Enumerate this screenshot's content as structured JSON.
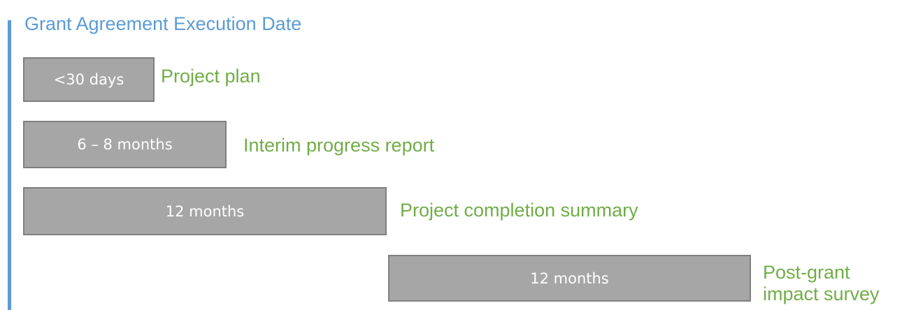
{
  "title": "Grant Agreement Execution Date",
  "colors": {
    "accent": "#5b9bd5",
    "label_text": "#70ad47",
    "bar_fill": "#a6a6a6",
    "bar_border": "#7f7f7f"
  },
  "milestones": [
    {
      "duration": "<30 days",
      "deliverable": "Project plan"
    },
    {
      "duration": "6 – 8 months",
      "deliverable": "Interim progress report"
    },
    {
      "duration": "12 months",
      "deliverable": "Project completion summary"
    },
    {
      "duration": "12 months",
      "deliverable_lines": [
        "Post-grant",
        "impact survey"
      ]
    }
  ]
}
